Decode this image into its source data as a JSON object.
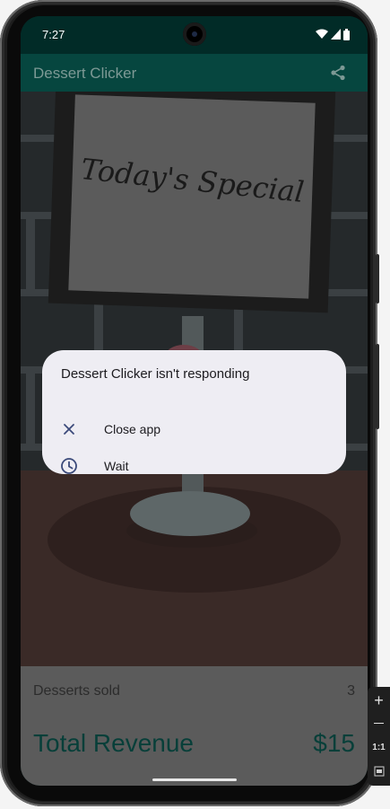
{
  "status_bar": {
    "time": "7:27"
  },
  "app_bar": {
    "title": "Dessert Clicker",
    "share_icon": "share-icon"
  },
  "sign": {
    "text": "Today's Special"
  },
  "bottom": {
    "desserts_sold_label": "Desserts sold",
    "desserts_sold_value": "3",
    "total_revenue_label": "Total Revenue",
    "total_revenue_value": "$15"
  },
  "dialog": {
    "title": "Dessert Clicker isn't responding",
    "options": [
      {
        "label": "Close app",
        "icon": "close-icon"
      },
      {
        "label": "Wait",
        "icon": "clock-icon"
      }
    ]
  },
  "emulator_toolbar": {
    "zoom_in": "+",
    "ratio_label": "1:1"
  },
  "colors": {
    "app_bar": "#06463f",
    "status_bar": "#012b27",
    "dialog_bg": "#eeedf3",
    "revenue_text": "#073f39",
    "dialog_icon": "#3b4a7a"
  }
}
